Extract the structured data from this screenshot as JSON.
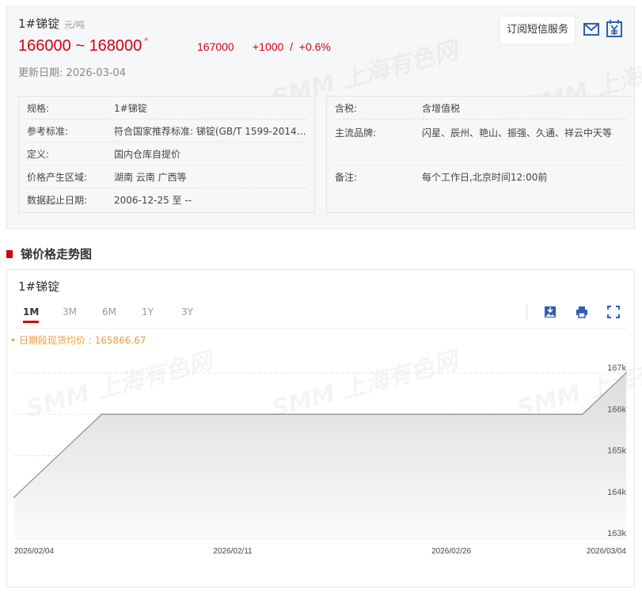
{
  "header": {
    "title": "1#锑锭",
    "unit": "元/吨",
    "price_low": "166000",
    "price_sep": "~",
    "price_high": "168000",
    "arrow": "^",
    "mid_price": "167000",
    "change": "+1000",
    "change_sep": "/",
    "change_pct": "+0.6%",
    "update_label": "更新日期:",
    "update_date": "2026-03-04",
    "subscribe_label": "订阅短信服务",
    "watermark": "SMM 上海有色网"
  },
  "left_info": [
    {
      "k": "规格:",
      "v": "1#锑锭"
    },
    {
      "k": "参考标准:",
      "v": "符合国家推荐标准: 锑锭(GB/T 1599-2014)S..."
    },
    {
      "k": "定义:",
      "v": "国内仓库自提价"
    },
    {
      "k": "价格产生区域:",
      "v": "湖南 云南 广西等"
    },
    {
      "k": "数据起止日期:",
      "v": "2006-12-25 至 --"
    }
  ],
  "right_info": [
    {
      "k": "含税:",
      "v": "含增值税"
    },
    {
      "k": "主流品牌:",
      "v": "闪星、辰州、艳山、振强、久通、祥云中天等"
    },
    {
      "k": "备注:",
      "v": "每个工作日,北京时间12:00前"
    }
  ],
  "section_title": "锑价格走势图",
  "chart": {
    "title": "1#锑锭",
    "tabs": [
      "1M",
      "3M",
      "6M",
      "1Y",
      "3Y"
    ],
    "active_tab": "1M",
    "avg_label": "• 日期段现货均价 : 165866.67"
  },
  "colors": {
    "accent": "#d4000f",
    "icon": "#2c5fb3",
    "avg": "#f39a3d"
  },
  "chart_data": {
    "type": "area",
    "x": [
      "2026/02/04",
      "2026/02/05",
      "2026/02/06",
      "2026/02/09",
      "2026/02/10",
      "2026/02/11",
      "2026/02/12",
      "2026/02/13",
      "2026/02/24",
      "2026/02/25",
      "2026/02/26",
      "2026/02/27",
      "2026/03/02",
      "2026/03/03",
      "2026/03/04"
    ],
    "values": [
      164000,
      165000,
      166000,
      166000,
      166000,
      166000,
      166000,
      166000,
      166000,
      166000,
      166000,
      166000,
      166000,
      166000,
      167000
    ],
    "x_tick_labels": [
      "2026/02/04",
      "2026/02/11",
      "2026/02/26",
      "2026/03/04"
    ],
    "x_tick_index": [
      0,
      5,
      10,
      14
    ],
    "y_ticks": [
      167000,
      166000,
      165000,
      164000,
      163000
    ],
    "y_tick_labels": [
      "167k",
      "166k",
      "165k",
      "164k",
      "163k"
    ],
    "ylim": [
      163000,
      167000
    ],
    "grid": true
  }
}
